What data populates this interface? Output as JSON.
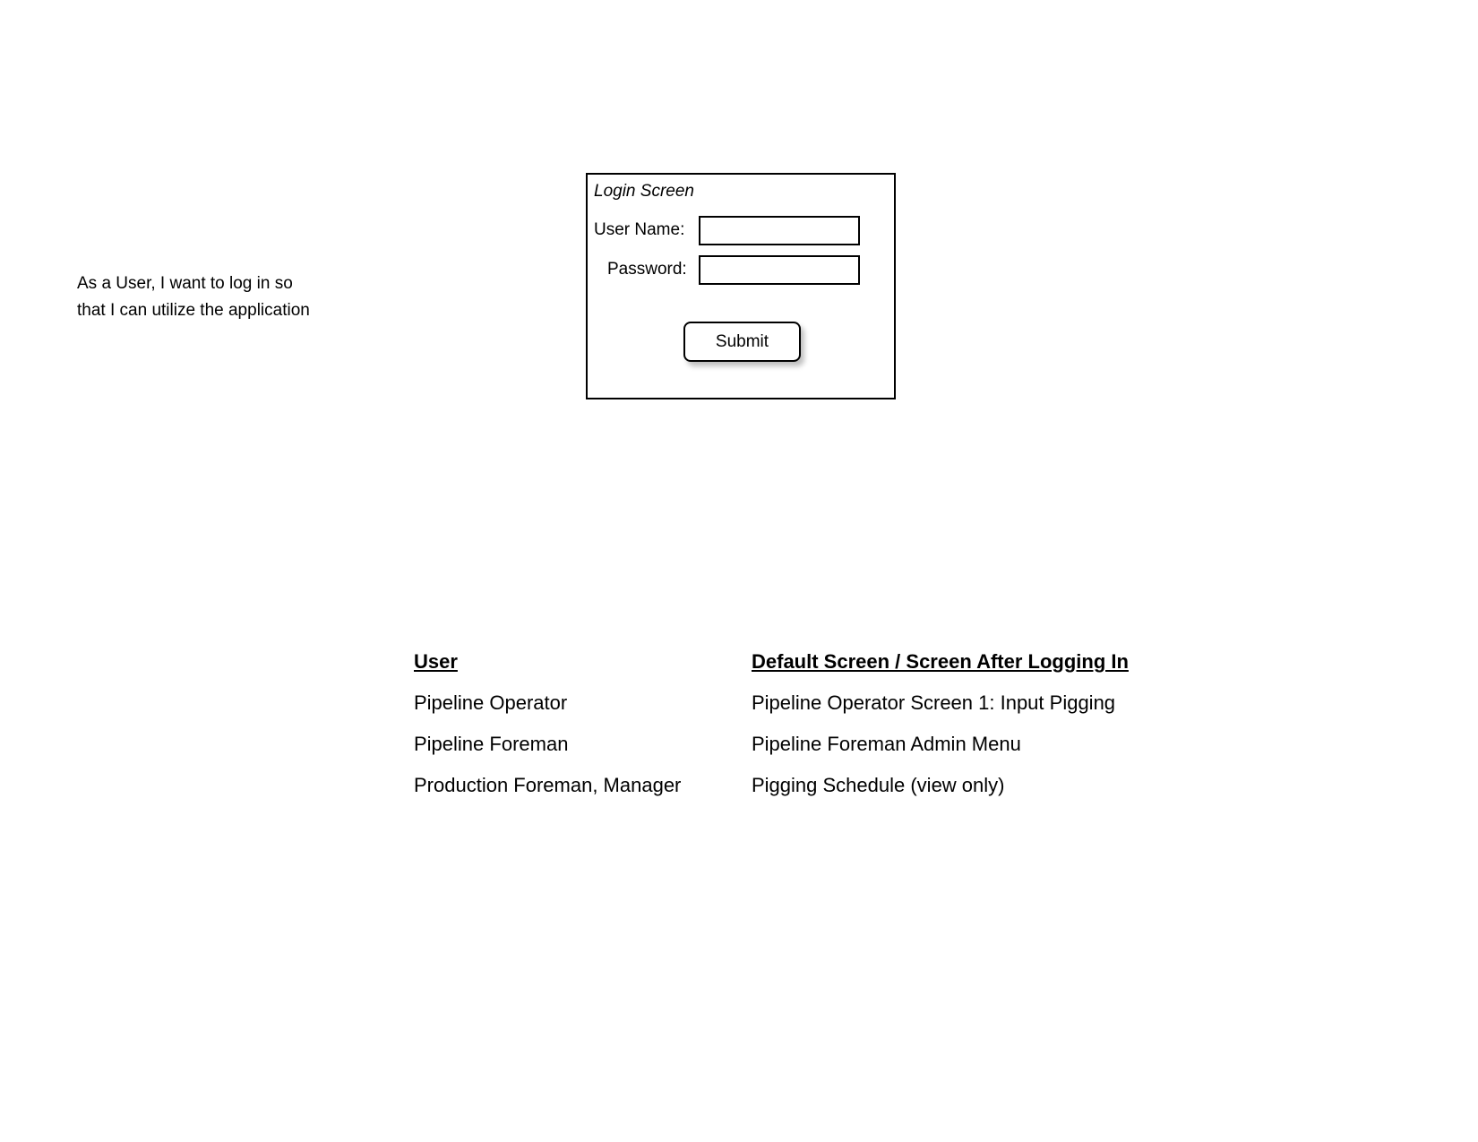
{
  "user_story": {
    "line1": "As a User, I want to log in so",
    "line2": "that I can utilize the application"
  },
  "login": {
    "title": "Login Screen",
    "username_label": "User Name:",
    "password_label": "Password:",
    "username_value": "",
    "password_value": "",
    "submit_label": "Submit"
  },
  "mapping": {
    "headers": {
      "user": "User",
      "screen": "Default Screen / Screen After Logging In"
    },
    "rows": [
      {
        "user": "Pipeline Operator",
        "screen": "Pipeline Operator Screen 1: Input Pigging"
      },
      {
        "user": "Pipeline Foreman",
        "screen": "Pipeline Foreman Admin Menu"
      },
      {
        "user": "Production Foreman, Manager",
        "screen": "Pigging Schedule (view only)"
      }
    ]
  }
}
